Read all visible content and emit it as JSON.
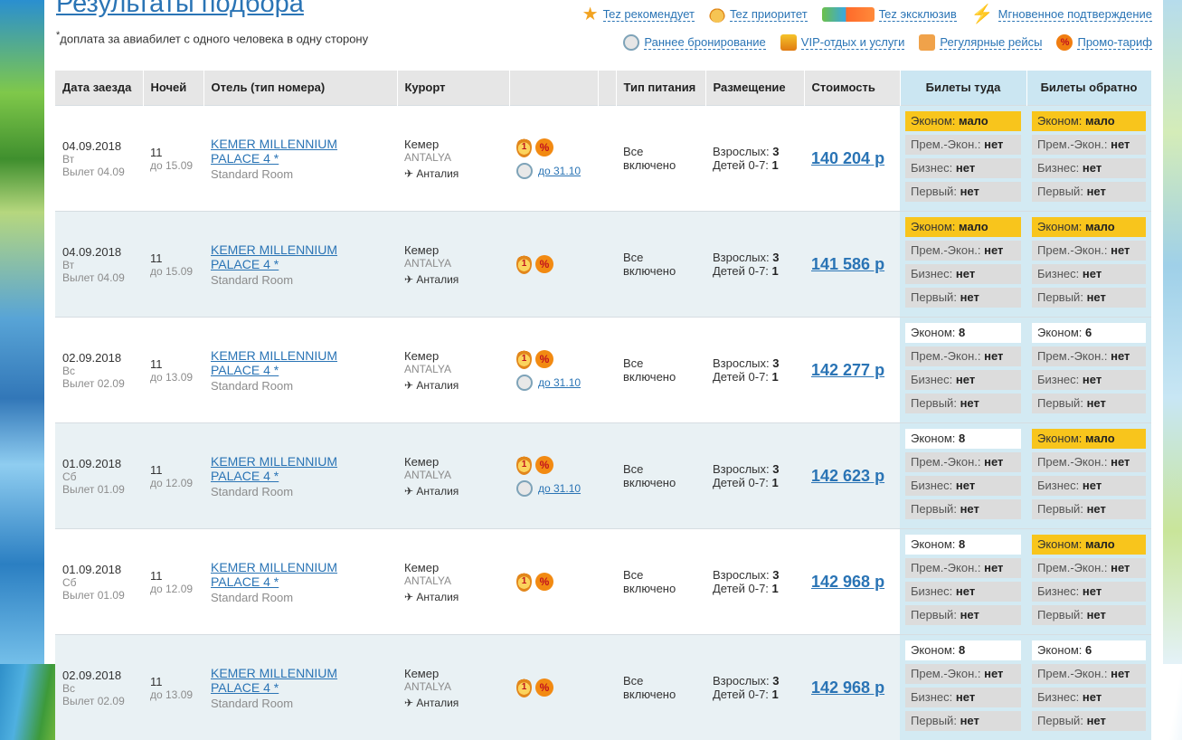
{
  "page": {
    "title": "Результаты подбора",
    "note_star": "*",
    "note": "доплата за авиабилет с одного человека в одну сторону"
  },
  "badges_row1": [
    {
      "icon": "star-icon",
      "label": "Tez рекомендует"
    },
    {
      "icon": "medal-icon",
      "label": "Tez приоритет"
    },
    {
      "icon": "only-icon",
      "label": "Tez эксклюзив"
    },
    {
      "icon": "lightning-icon",
      "label": "Мгновенное подтверждение"
    }
  ],
  "badges_row2": [
    {
      "icon": "clock-icon",
      "label": "Раннее бронирование"
    },
    {
      "icon": "vip-icon",
      "label": "VIP-отдых и услуги"
    },
    {
      "icon": "calendar-plane-icon",
      "label": "Регулярные рейсы"
    },
    {
      "icon": "percent-icon",
      "label": "Промо-тариф"
    }
  ],
  "table": {
    "headers": {
      "date": "Дата заезда",
      "nights": "Ночей",
      "hotel": "Отель (тип номера)",
      "resort": "Курорт",
      "meal": "Тип питания",
      "placement": "Размещение",
      "cost": "Стоимость",
      "tickets_out": "Билеты туда",
      "tickets_back": "Билеты обратно"
    },
    "rows": [
      {
        "date": "04.09.2018",
        "dow": "Вт",
        "flight": "Вылет 04.09",
        "nights": "11",
        "until": "до 15.09",
        "hotel": "KEMER MILLENNIUM PALACE 4 *",
        "room": "Standard Room",
        "resort": "Кемер",
        "region": "ANTALYA",
        "airport": "Анталия",
        "early": "до 31.10",
        "meal": "Все включено",
        "adults_label": "Взрослых:",
        "adults": "3",
        "kids_label": "Детей 0-7:",
        "kids": "1",
        "price": "140 204 р",
        "out": [
          {
            "cls": "Эконом:",
            "val": "мало",
            "state": "few"
          },
          {
            "cls": "Прем.-Экон.:",
            "val": "нет",
            "state": "none"
          },
          {
            "cls": "Бизнес:",
            "val": "нет",
            "state": "none"
          },
          {
            "cls": "Первый:",
            "val": "нет",
            "state": "none"
          }
        ],
        "back": [
          {
            "cls": "Эконом:",
            "val": "мало",
            "state": "few"
          },
          {
            "cls": "Прем.-Экон.:",
            "val": "нет",
            "state": "none"
          },
          {
            "cls": "Бизнес:",
            "val": "нет",
            "state": "none"
          },
          {
            "cls": "Первый:",
            "val": "нет",
            "state": "none"
          }
        ]
      },
      {
        "date": "04.09.2018",
        "dow": "Вт",
        "flight": "Вылет 04.09",
        "nights": "11",
        "until": "до 15.09",
        "hotel": "KEMER MILLENNIUM PALACE 4 *",
        "room": "Standard Room",
        "resort": "Кемер",
        "region": "ANTALYA",
        "airport": "Анталия",
        "early": "",
        "meal": "Все включено",
        "adults_label": "Взрослых:",
        "adults": "3",
        "kids_label": "Детей 0-7:",
        "kids": "1",
        "price": "141 586 р",
        "out": [
          {
            "cls": "Эконом:",
            "val": "мало",
            "state": "few"
          },
          {
            "cls": "Прем.-Экон.:",
            "val": "нет",
            "state": "none"
          },
          {
            "cls": "Бизнес:",
            "val": "нет",
            "state": "none"
          },
          {
            "cls": "Первый:",
            "val": "нет",
            "state": "none"
          }
        ],
        "back": [
          {
            "cls": "Эконом:",
            "val": "мало",
            "state": "few"
          },
          {
            "cls": "Прем.-Экон.:",
            "val": "нет",
            "state": "none"
          },
          {
            "cls": "Бизнес:",
            "val": "нет",
            "state": "none"
          },
          {
            "cls": "Первый:",
            "val": "нет",
            "state": "none"
          }
        ]
      },
      {
        "date": "02.09.2018",
        "dow": "Вс",
        "flight": "Вылет 02.09",
        "nights": "11",
        "until": "до 13.09",
        "hotel": "KEMER MILLENNIUM PALACE 4 *",
        "room": "Standard Room",
        "resort": "Кемер",
        "region": "ANTALYA",
        "airport": "Анталия",
        "early": "до 31.10",
        "meal": "Все включено",
        "adults_label": "Взрослых:",
        "adults": "3",
        "kids_label": "Детей 0-7:",
        "kids": "1",
        "price": "142 277 р",
        "out": [
          {
            "cls": "Эконом:",
            "val": "8",
            "state": "ok"
          },
          {
            "cls": "Прем.-Экон.:",
            "val": "нет",
            "state": "none"
          },
          {
            "cls": "Бизнес:",
            "val": "нет",
            "state": "none"
          },
          {
            "cls": "Первый:",
            "val": "нет",
            "state": "none"
          }
        ],
        "back": [
          {
            "cls": "Эконом:",
            "val": "6",
            "state": "ok"
          },
          {
            "cls": "Прем.-Экон.:",
            "val": "нет",
            "state": "none"
          },
          {
            "cls": "Бизнес:",
            "val": "нет",
            "state": "none"
          },
          {
            "cls": "Первый:",
            "val": "нет",
            "state": "none"
          }
        ]
      },
      {
        "date": "01.09.2018",
        "dow": "Сб",
        "flight": "Вылет 01.09",
        "nights": "11",
        "until": "до 12.09",
        "hotel": "KEMER MILLENNIUM PALACE 4 *",
        "room": "Standard Room",
        "resort": "Кемер",
        "region": "ANTALYA",
        "airport": "Анталия",
        "early": "до 31.10",
        "meal": "Все включено",
        "adults_label": "Взрослых:",
        "adults": "3",
        "kids_label": "Детей 0-7:",
        "kids": "1",
        "price": "142 623 р",
        "out": [
          {
            "cls": "Эконом:",
            "val": "8",
            "state": "ok"
          },
          {
            "cls": "Прем.-Экон.:",
            "val": "нет",
            "state": "none"
          },
          {
            "cls": "Бизнес:",
            "val": "нет",
            "state": "none"
          },
          {
            "cls": "Первый:",
            "val": "нет",
            "state": "none"
          }
        ],
        "back": [
          {
            "cls": "Эконом:",
            "val": "мало",
            "state": "few"
          },
          {
            "cls": "Прем.-Экон.:",
            "val": "нет",
            "state": "none"
          },
          {
            "cls": "Бизнес:",
            "val": "нет",
            "state": "none"
          },
          {
            "cls": "Первый:",
            "val": "нет",
            "state": "none"
          }
        ]
      },
      {
        "date": "01.09.2018",
        "dow": "Сб",
        "flight": "Вылет 01.09",
        "nights": "11",
        "until": "до 12.09",
        "hotel": "KEMER MILLENNIUM PALACE 4 *",
        "room": "Standard Room",
        "resort": "Кемер",
        "region": "ANTALYA",
        "airport": "Анталия",
        "early": "",
        "meal": "Все включено",
        "adults_label": "Взрослых:",
        "adults": "3",
        "kids_label": "Детей 0-7:",
        "kids": "1",
        "price": "142 968 р",
        "out": [
          {
            "cls": "Эконом:",
            "val": "8",
            "state": "ok"
          },
          {
            "cls": "Прем.-Экон.:",
            "val": "нет",
            "state": "none"
          },
          {
            "cls": "Бизнес:",
            "val": "нет",
            "state": "none"
          },
          {
            "cls": "Первый:",
            "val": "нет",
            "state": "none"
          }
        ],
        "back": [
          {
            "cls": "Эконом:",
            "val": "мало",
            "state": "few"
          },
          {
            "cls": "Прем.-Экон.:",
            "val": "нет",
            "state": "none"
          },
          {
            "cls": "Бизнес:",
            "val": "нет",
            "state": "none"
          },
          {
            "cls": "Первый:",
            "val": "нет",
            "state": "none"
          }
        ]
      },
      {
        "date": "02.09.2018",
        "dow": "Вс",
        "flight": "Вылет 02.09",
        "nights": "11",
        "until": "до 13.09",
        "hotel": "KEMER MILLENNIUM PALACE 4 *",
        "room": "Standard Room",
        "resort": "Кемер",
        "region": "ANTALYA",
        "airport": "Анталия",
        "early": "",
        "meal": "Все включено",
        "adults_label": "Взрослых:",
        "adults": "3",
        "kids_label": "Детей 0-7:",
        "kids": "1",
        "price": "142 968 р",
        "out": [
          {
            "cls": "Эконом:",
            "val": "8",
            "state": "ok"
          },
          {
            "cls": "Прем.-Экон.:",
            "val": "нет",
            "state": "none"
          },
          {
            "cls": "Бизнес:",
            "val": "нет",
            "state": "none"
          },
          {
            "cls": "Первый:",
            "val": "нет",
            "state": "none"
          }
        ],
        "back": [
          {
            "cls": "Эконом:",
            "val": "6",
            "state": "ok"
          },
          {
            "cls": "Прем.-Экон.:",
            "val": "нет",
            "state": "none"
          },
          {
            "cls": "Бизнес:",
            "val": "нет",
            "state": "none"
          },
          {
            "cls": "Первый:",
            "val": "нет",
            "state": "none"
          }
        ]
      }
    ]
  },
  "colors": {
    "link": "#2a74b5",
    "few": "#f8c51c",
    "header": "#e6e6e6",
    "tickets_header": "#cbe6f2",
    "row_alt": "#e9f1f4"
  }
}
